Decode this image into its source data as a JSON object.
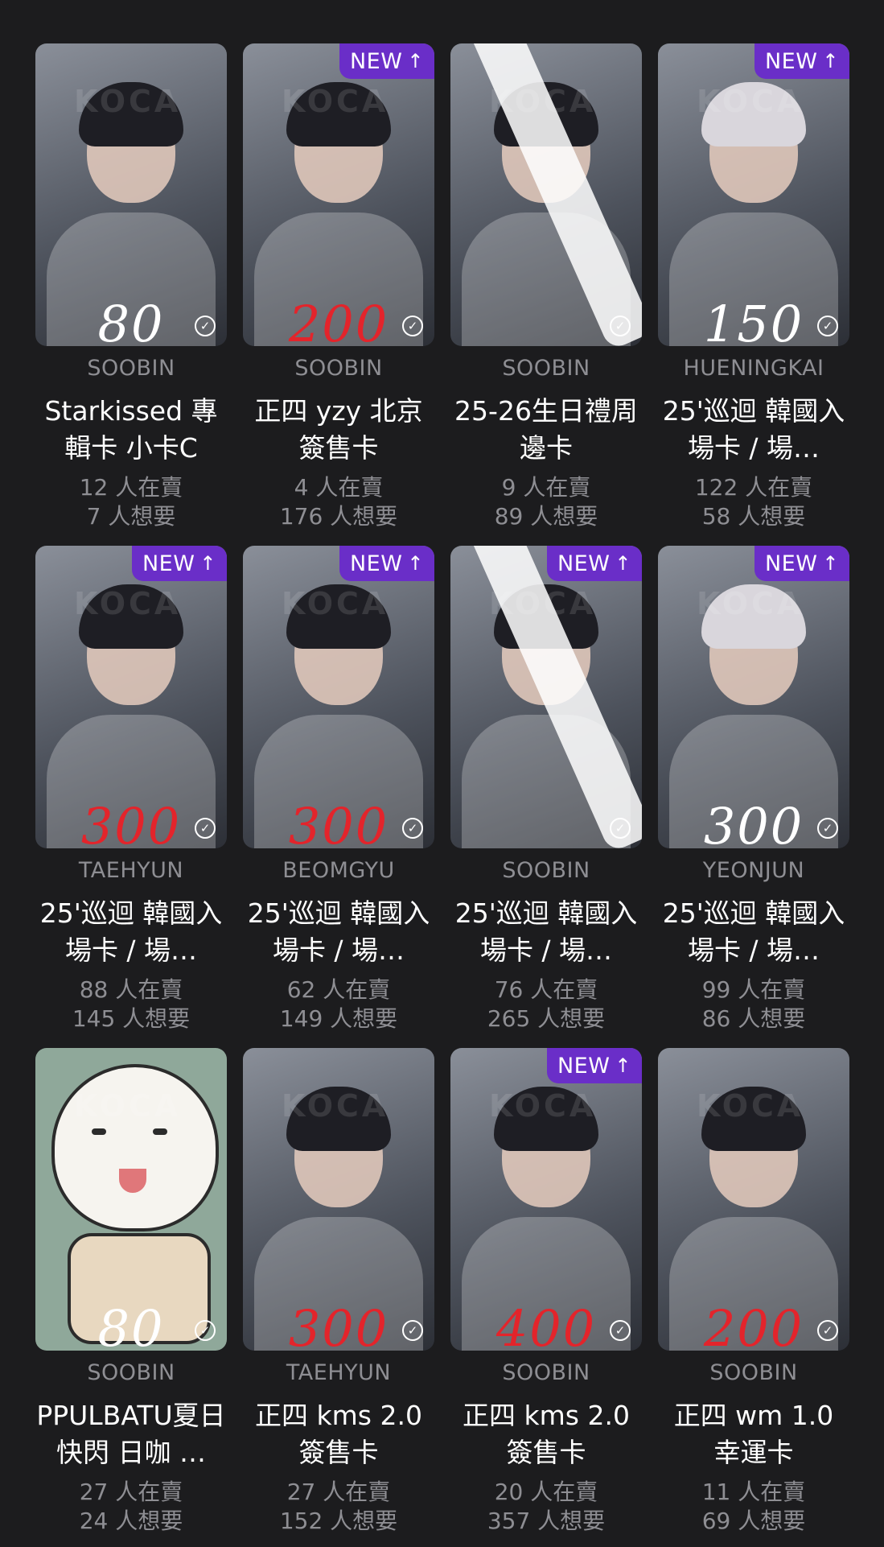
{
  "watermark": "KOCA",
  "check_icon": "check-circle-icon",
  "new_badge": {
    "label": "NEW",
    "arrow": "↑"
  },
  "cards": [
    {
      "price": "80",
      "price_color": "white",
      "new": false,
      "struck": false,
      "member": "SOOBIN",
      "title": "Starkissed 專輯卡 小卡C",
      "sellers": "12 人在賣",
      "wanters": "7 人想要"
    },
    {
      "price": "200",
      "price_color": "red",
      "new": true,
      "struck": false,
      "member": "SOOBIN",
      "title": "正四 yzy 北京簽售卡",
      "sellers": "4 人在賣",
      "wanters": "176 人想要"
    },
    {
      "price": "",
      "price_color": "white",
      "new": false,
      "struck": true,
      "member": "SOOBIN",
      "title": "25-26生日禮周邊卡",
      "sellers": "9 人在賣",
      "wanters": "89 人想要"
    },
    {
      "price": "150",
      "price_color": "white",
      "new": true,
      "struck": false,
      "member": "HUENINGKAI",
      "title": "25'巡迴 韓國入場卡 / 場…",
      "sellers": "122 人在賣",
      "wanters": "58 人想要"
    },
    {
      "price": "300",
      "price_color": "red",
      "new": true,
      "struck": false,
      "member": "TAEHYUN",
      "title": "25'巡迴 韓國入場卡 / 場…",
      "sellers": "88 人在賣",
      "wanters": "145 人想要"
    },
    {
      "price": "300",
      "price_color": "red",
      "new": true,
      "struck": false,
      "member": "BEOMGYU",
      "title": "25'巡迴 韓國入場卡 / 場…",
      "sellers": "62 人在賣",
      "wanters": "149 人想要"
    },
    {
      "price": "",
      "price_color": "white",
      "new": true,
      "struck": true,
      "member": "SOOBIN",
      "title": "25'巡迴 韓國入場卡 / 場…",
      "sellers": "76 人在賣",
      "wanters": "265 人想要"
    },
    {
      "price": "300",
      "price_color": "white",
      "new": true,
      "struck": false,
      "member": "YEONJUN",
      "title": "25'巡迴 韓國入場卡 / 場…",
      "sellers": "99 人在賣",
      "wanters": "86 人想要"
    },
    {
      "price": "80",
      "price_color": "white",
      "new": false,
      "struck": false,
      "member": "SOOBIN",
      "title": "PPULBATU夏日快閃 日咖 …",
      "sellers": "27 人在賣",
      "wanters": "24 人想要",
      "dog": true
    },
    {
      "price": "300",
      "price_color": "red",
      "new": false,
      "struck": false,
      "member": "TAEHYUN",
      "title": "正四 kms 2.0 簽售卡",
      "sellers": "27 人在賣",
      "wanters": "152 人想要"
    },
    {
      "price": "400",
      "price_color": "red",
      "new": true,
      "struck": false,
      "member": "SOOBIN",
      "title": "正四 kms 2.0 簽售卡",
      "sellers": "20 人在賣",
      "wanters": "357 人想要"
    },
    {
      "price": "200",
      "price_color": "red",
      "new": false,
      "struck": false,
      "member": "SOOBIN",
      "title": "正四 wm 1.0 幸運卡",
      "sellers": "11 人在賣",
      "wanters": "69 人想要"
    }
  ]
}
